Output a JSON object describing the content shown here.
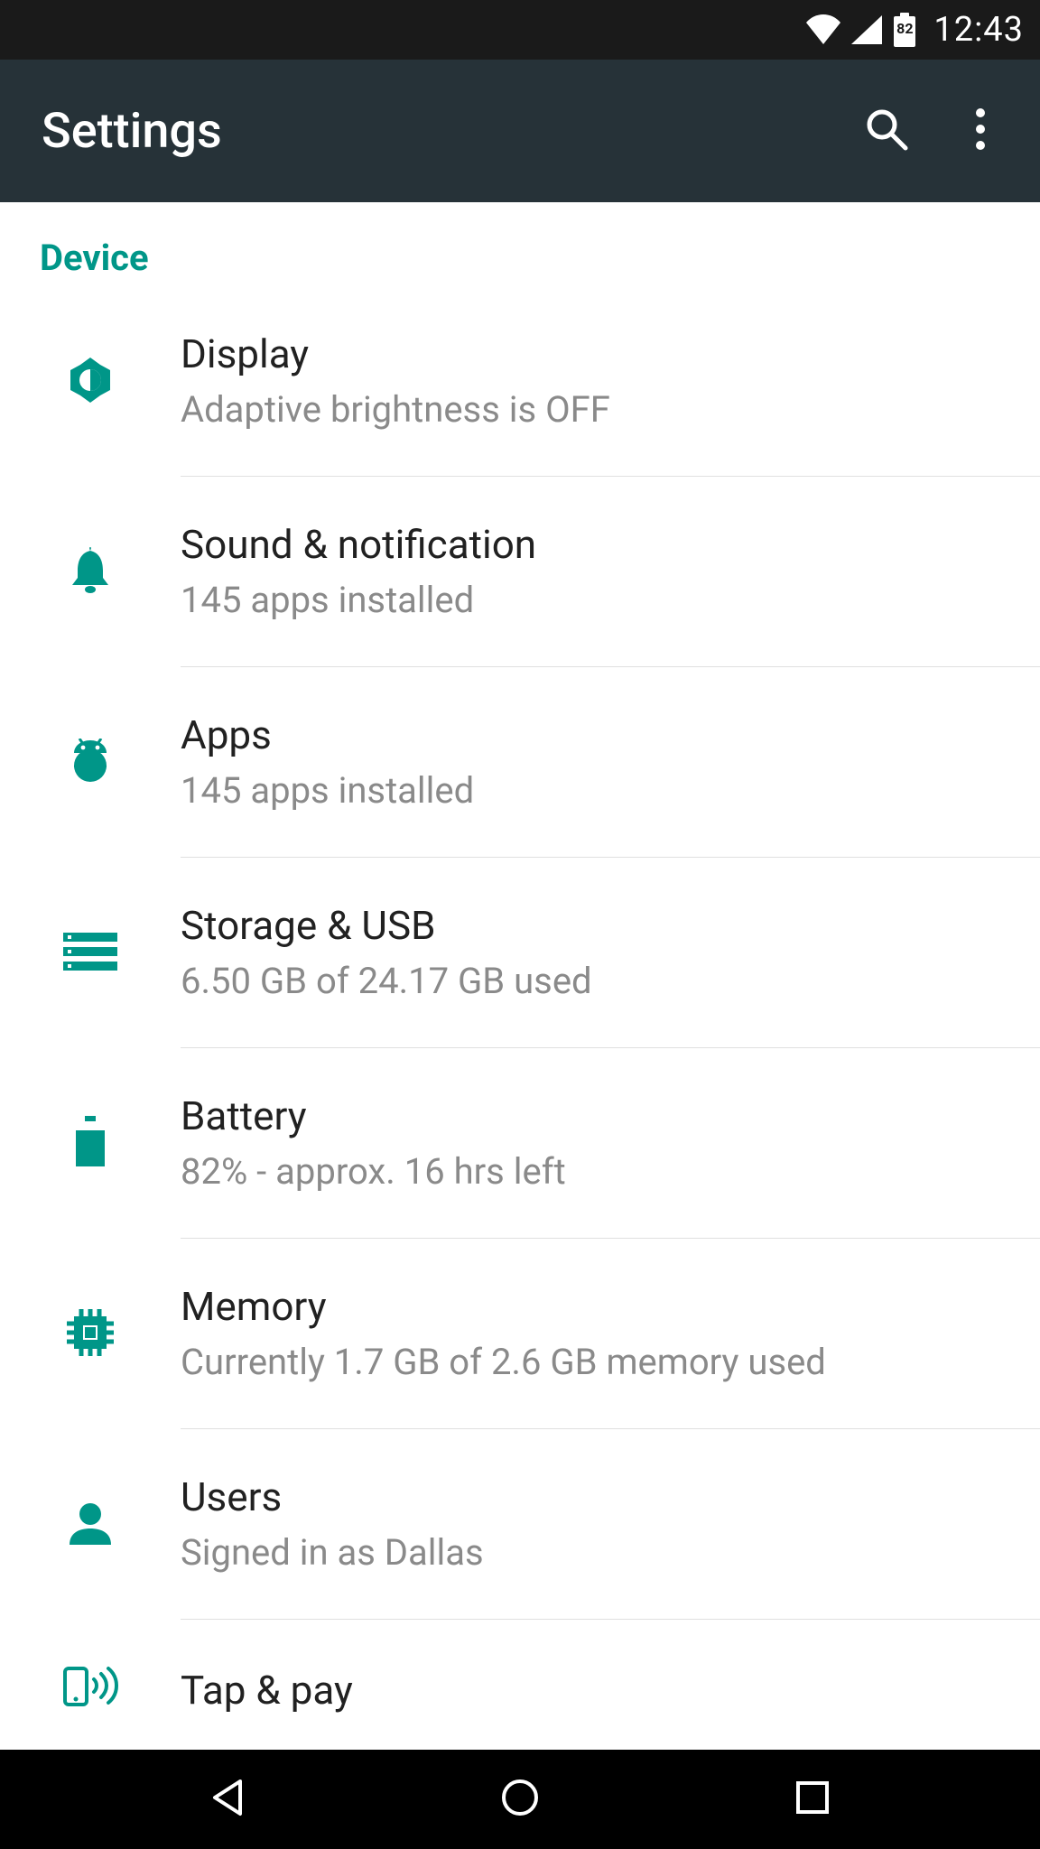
{
  "statusbar": {
    "battery_text": "82",
    "clock": "12:43"
  },
  "appbar": {
    "title": "Settings"
  },
  "section": {
    "label": "Device"
  },
  "items": [
    {
      "title": "Display",
      "subtitle": "Adaptive brightness is OFF"
    },
    {
      "title": "Sound & notification",
      "subtitle": "145 apps installed"
    },
    {
      "title": "Apps",
      "subtitle": "145 apps installed"
    },
    {
      "title": "Storage & USB",
      "subtitle": "6.50 GB of 24.17 GB used"
    },
    {
      "title": "Battery",
      "subtitle": "82% - approx. 16 hrs left"
    },
    {
      "title": "Memory",
      "subtitle": "Currently 1.7 GB of 2.6 GB memory used"
    },
    {
      "title": "Users",
      "subtitle": "Signed in as Dallas"
    },
    {
      "title": "Tap & pay",
      "subtitle": ""
    }
  ],
  "colors": {
    "accent": "#009688",
    "appbar_bg": "#263238"
  }
}
